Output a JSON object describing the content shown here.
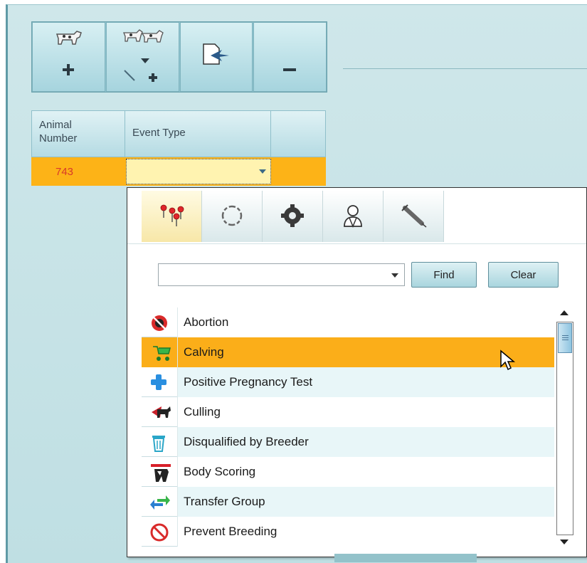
{
  "toolbar": {
    "buttons": [
      {
        "name": "add-animal",
        "icon": "cow-plus-icon"
      },
      {
        "name": "edit-add-animals",
        "icon": "cows-edit-plus-icon"
      },
      {
        "name": "import",
        "icon": "import-arrow-icon"
      },
      {
        "name": "remove",
        "icon": "minus-icon"
      }
    ]
  },
  "grid": {
    "columns": [
      "Animal\nNumber",
      "Event Type",
      ""
    ],
    "rows": [
      {
        "animal_number": "743",
        "event_type": ""
      }
    ]
  },
  "popup": {
    "tabs": [
      {
        "icon": "pushpins-icon",
        "active": true
      },
      {
        "icon": "cycle-arrows-icon",
        "active": false
      },
      {
        "icon": "gear-icon",
        "active": false
      },
      {
        "icon": "veterinarian-icon",
        "active": false
      },
      {
        "icon": "syringe-icon",
        "active": false
      }
    ],
    "search": {
      "value": "",
      "placeholder": ""
    },
    "find_label": "Find",
    "clear_label": "Clear",
    "events": [
      {
        "label": "Abortion",
        "icon": "no-pregnancy-icon",
        "selected": false
      },
      {
        "label": "Calving",
        "icon": "stroller-icon",
        "selected": true
      },
      {
        "label": "Positive Pregnancy Test",
        "icon": "blue-cross-icon",
        "selected": false
      },
      {
        "label": "Culling",
        "icon": "cow-out-icon",
        "selected": false
      },
      {
        "label": "Disqualified by Breeder",
        "icon": "trash-bin-icon",
        "selected": false
      },
      {
        "label": "Body Scoring",
        "icon": "cow-ruler-icon",
        "selected": false
      },
      {
        "label": "Transfer Group",
        "icon": "swap-arrows-icon",
        "selected": false
      },
      {
        "label": "Prevent Breeding",
        "icon": "prohibited-icon",
        "selected": false
      }
    ]
  },
  "colors": {
    "selected_row": "#fbae19",
    "accent_teal": "#a9d5de",
    "animal_number_text": "#d8392a"
  }
}
